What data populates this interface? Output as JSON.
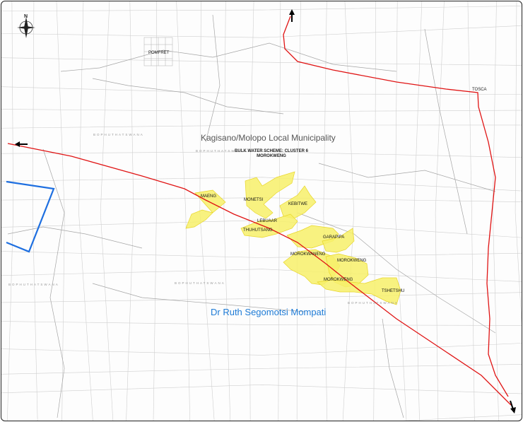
{
  "map": {
    "north_label": "N",
    "municipality_label": "Kagisano/Molopo Local Municipality",
    "district_label": "Dr Ruth Segomotsi Mompati",
    "scheme_title": "BULK WATER SCHEME: CLUSTER 6",
    "scheme_subtitle": "MOROKWENG",
    "towns": {
      "pomfret": "POMFRET",
      "tosca": "TOSCA",
      "maeng": "MAENG",
      "monetsi": "MONETSI",
      "kebitwe": "KEBITWE",
      "lebuaar": "LEBUAAR",
      "thuhutsang": "THUHUTSANG",
      "garapipa": "GARAPIPA",
      "morokwaneng": "MOROKWANENG",
      "morokweng_east": "MOROKWENG",
      "morokweng": "MOROKWENG",
      "tshetshu": "TSHETSHU"
    },
    "faint_labels": {
      "bophuthatswana_nw": "BOPHUTHATSWANA",
      "bophuthatswana_center": "BOPHUTHATSWANA",
      "bophuthatswana_top": "BOPHUTHATSWANA",
      "bophuthatswana_west": "BOPHUTHATSWANA",
      "bophuthatswana_se": "BOPHUTHATSWANA"
    },
    "colors": {
      "road": "#e01414",
      "cluster_fill": "#f7f06a",
      "boundary": "#1e6fe0",
      "district_text": "#1e7bd6",
      "grid": "#c8c8c8"
    },
    "icons": [
      "north-arrow-icon",
      "direction-arrow-icon"
    ]
  }
}
